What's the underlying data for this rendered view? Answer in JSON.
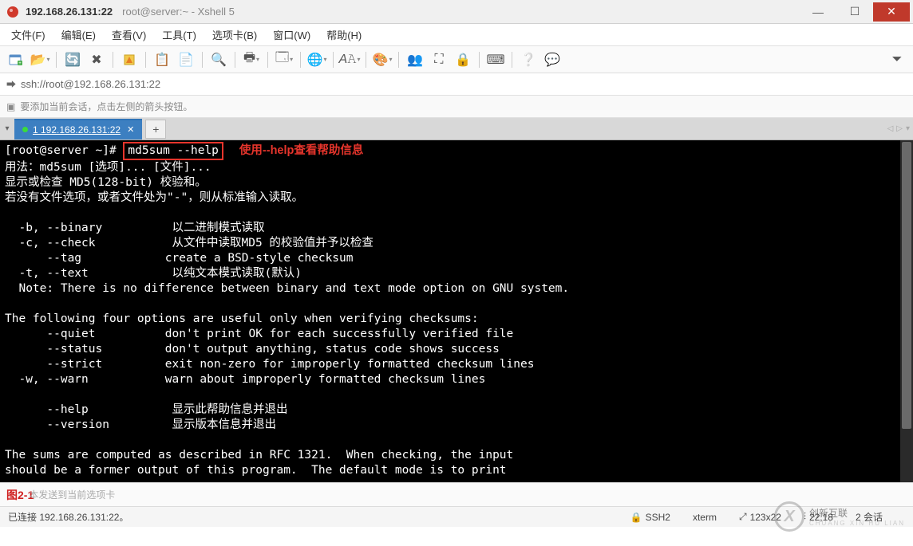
{
  "titlebar": {
    "host": "192.168.26.131:22",
    "rest": "root@server:~ - Xshell 5"
  },
  "menu": {
    "file": "文件(F)",
    "edit": "编辑(E)",
    "view": "查看(V)",
    "tools": "工具(T)",
    "tabs": "选项卡(B)",
    "window": "窗口(W)",
    "help": "帮助(H)"
  },
  "addressbar": {
    "url": "ssh://root@192.168.26.131:22"
  },
  "hintbar": {
    "text": "要添加当前会话，点击左侧的箭头按钮。"
  },
  "tab": {
    "label": "1 192.168.26.131:22"
  },
  "terminal": {
    "prompt": "[root@server ~]#",
    "command": "md5sum --help",
    "annotation": "使用--help查看帮助信息",
    "lines": [
      "用法：md5sum [选项]... [文件]...",
      "显示或检查 MD5(128-bit) 校验和。",
      "若没有文件选项，或者文件处为\"-\"，则从标准输入读取。",
      "",
      "  -b, --binary          以二进制模式读取",
      "  -c, --check           从文件中读取MD5 的校验值并予以检查",
      "      --tag            create a BSD-style checksum",
      "  -t, --text            以纯文本模式读取(默认)",
      "  Note: There is no difference between binary and text mode option on GNU system.",
      "",
      "The following four options are useful only when verifying checksums:",
      "      --quiet          don't print OK for each successfully verified file",
      "      --status         don't output anything, status code shows success",
      "      --strict         exit non-zero for improperly formatted checksum lines",
      "  -w, --warn           warn about improperly formatted checksum lines",
      "",
      "      --help\t\t显示此帮助信息并退出",
      "      --version\t\t显示版本信息并退出",
      "",
      "The sums are computed as described in RFC 1321.  When checking, the input",
      "should be a former output of this program.  The default mode is to print"
    ]
  },
  "sendbar": {
    "figlabel": "图2-1",
    "placeholder": "本发送到当前选项卡"
  },
  "statusbar": {
    "conn": "已连接 192.168.26.131:22。",
    "proto": "SSH2",
    "term": "xterm",
    "size": "123x22",
    "pos": "22,18",
    "sessions": "2 会话"
  },
  "watermark": {
    "main": "创新互联",
    "sub": "CHUANG XIN HU LIAN"
  },
  "icons": {
    "lock": "🔒",
    "sizearrow": "⤢",
    "posicon": "⫶"
  }
}
